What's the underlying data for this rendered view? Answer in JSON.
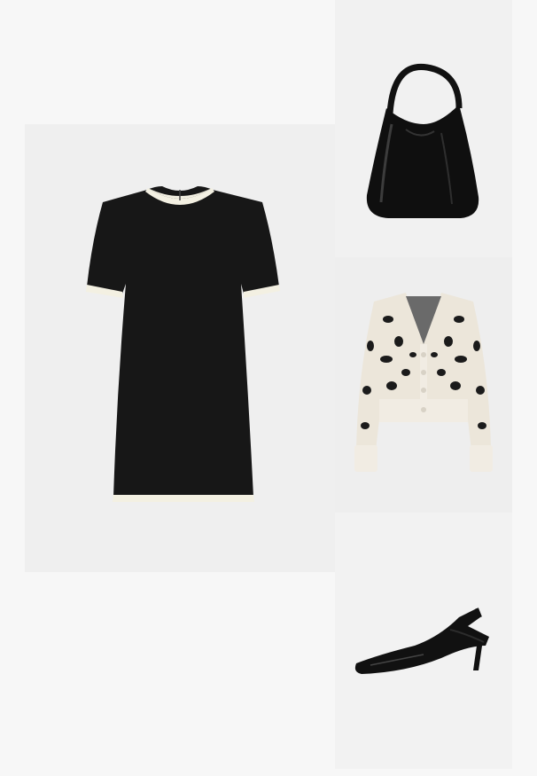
{
  "outfit": {
    "items": [
      {
        "name": "dress",
        "icon": "black-shift-dress-with-cream-trim"
      },
      {
        "name": "bag",
        "icon": "black-patent-hobo-bag"
      },
      {
        "name": "cardigan",
        "icon": "leopard-print-cropped-cardigan"
      },
      {
        "name": "shoe",
        "icon": "black-patent-slingback-kitten-heel"
      }
    ]
  },
  "colors": {
    "page_bg": "#f7f7f7",
    "tile_bg": "#efefef",
    "dress": "#171717",
    "trim": "#f3f0e2",
    "cardigan_base": "#ece6da",
    "leopard_spot": "#1b1b1b"
  }
}
